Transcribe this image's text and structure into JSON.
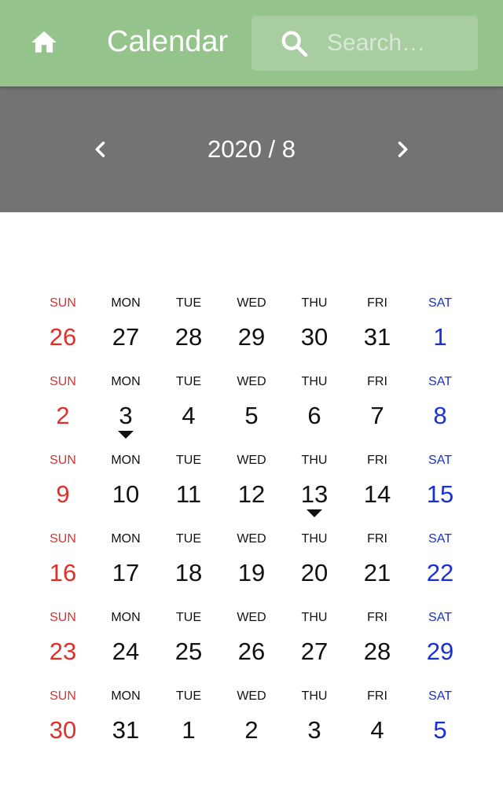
{
  "header": {
    "title": "Calendar",
    "home_icon": "home-icon",
    "search_icon": "search-icon",
    "search_placeholder": "Search…",
    "search_value": "",
    "color": "#94c38b"
  },
  "month_nav": {
    "label": "2020 / 8",
    "prev_icon": "chevron-left-icon",
    "next_icon": "chevron-right-icon",
    "color": "#737373"
  },
  "colors": {
    "sunday": "#e0302c",
    "saturday": "#1a2fd6",
    "weekday": "#111111"
  },
  "calendar": {
    "weekday_labels": [
      "SUN",
      "MON",
      "TUE",
      "WED",
      "THU",
      "FRI",
      "SAT"
    ],
    "weeks": [
      {
        "days": [
          {
            "date": "26"
          },
          {
            "date": "27"
          },
          {
            "date": "28"
          },
          {
            "date": "29"
          },
          {
            "date": "30"
          },
          {
            "date": "31"
          },
          {
            "date": "1"
          }
        ]
      },
      {
        "days": [
          {
            "date": "2"
          },
          {
            "date": "3",
            "marked": true
          },
          {
            "date": "4"
          },
          {
            "date": "5"
          },
          {
            "date": "6"
          },
          {
            "date": "7"
          },
          {
            "date": "8"
          }
        ]
      },
      {
        "days": [
          {
            "date": "9"
          },
          {
            "date": "10"
          },
          {
            "date": "11"
          },
          {
            "date": "12"
          },
          {
            "date": "13",
            "marked": true
          },
          {
            "date": "14"
          },
          {
            "date": "15"
          }
        ]
      },
      {
        "days": [
          {
            "date": "16"
          },
          {
            "date": "17"
          },
          {
            "date": "18"
          },
          {
            "date": "19"
          },
          {
            "date": "20"
          },
          {
            "date": "21"
          },
          {
            "date": "22"
          }
        ]
      },
      {
        "days": [
          {
            "date": "23"
          },
          {
            "date": "24"
          },
          {
            "date": "25"
          },
          {
            "date": "26"
          },
          {
            "date": "27"
          },
          {
            "date": "28"
          },
          {
            "date": "29"
          }
        ]
      },
      {
        "days": [
          {
            "date": "30"
          },
          {
            "date": "31"
          },
          {
            "date": "1"
          },
          {
            "date": "2"
          },
          {
            "date": "3"
          },
          {
            "date": "4"
          },
          {
            "date": "5"
          }
        ]
      }
    ]
  }
}
